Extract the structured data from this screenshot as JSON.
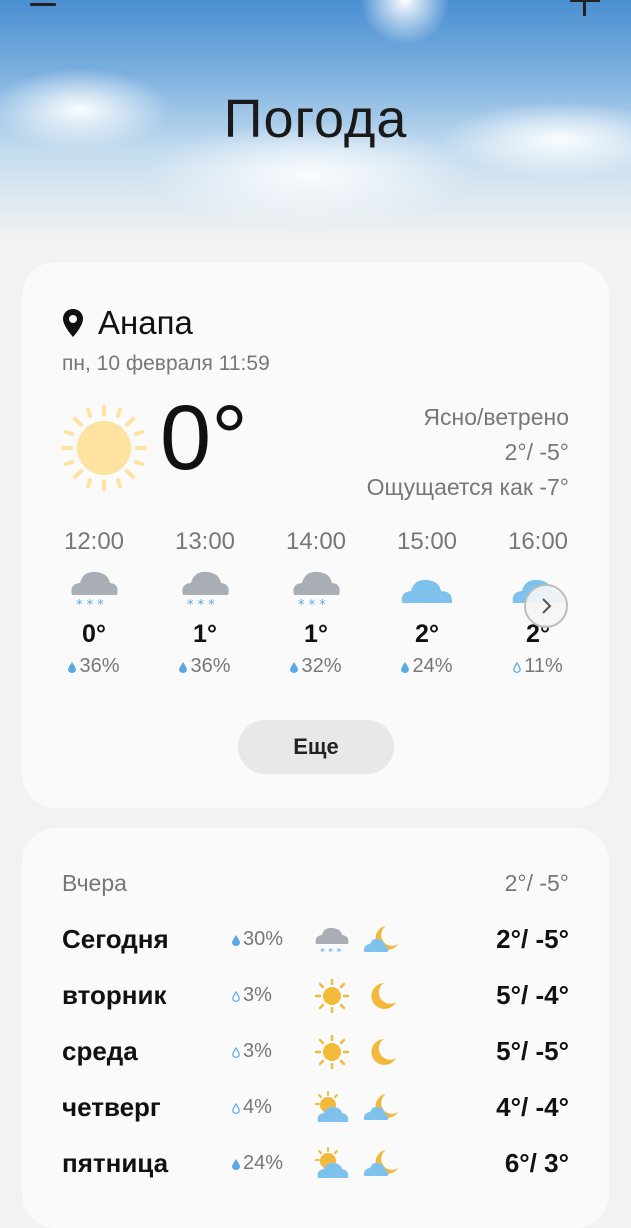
{
  "app": {
    "title": "Погода"
  },
  "current": {
    "city": "Анапа",
    "datetime": "пн, 10 февраля 11:59",
    "temp": "0°",
    "condition": "Ясно/ветрено",
    "hi_lo": "2°/ -5°",
    "feels_like": "Ощущается как -7°",
    "icon": "sun-icon"
  },
  "hourly": [
    {
      "time": "12:00",
      "temp": "0°",
      "precip": "36%",
      "icon": "snow-cloud-icon"
    },
    {
      "time": "13:00",
      "temp": "1°",
      "precip": "36%",
      "icon": "snow-cloud-icon"
    },
    {
      "time": "14:00",
      "temp": "1°",
      "precip": "32%",
      "icon": "snow-cloud-icon"
    },
    {
      "time": "15:00",
      "temp": "2°",
      "precip": "24%",
      "icon": "cloud-icon"
    },
    {
      "time": "16:00",
      "temp": "2°",
      "precip": "11%",
      "icon": "cloud-icon"
    }
  ],
  "buttons": {
    "more": "Еще"
  },
  "forecast": {
    "yesterday_label": "Вчера",
    "yesterday_temp": "2°/ -5°",
    "days": [
      {
        "name": "Сегодня",
        "precip": "30%",
        "day_icon": "snow-cloud-icon",
        "night_icon": "moon-cloud-icon",
        "temps": "2°/ -5°"
      },
      {
        "name": "вторник",
        "precip": "3%",
        "day_icon": "sun-icon",
        "night_icon": "moon-icon",
        "temps": "5°/ -4°"
      },
      {
        "name": "среда",
        "precip": "3%",
        "day_icon": "sun-icon",
        "night_icon": "moon-icon",
        "temps": "5°/ -5°"
      },
      {
        "name": "четверг",
        "precip": "4%",
        "day_icon": "sun-cloud-icon",
        "night_icon": "moon-cloud-icon",
        "temps": "4°/ -4°"
      },
      {
        "name": "пятница",
        "precip": "24%",
        "day_icon": "sun-cloud-icon",
        "night_icon": "moon-cloud-icon",
        "temps": "6°/ 3°"
      }
    ]
  },
  "colors": {
    "sun": "#fde2a0",
    "cloud_blue": "#7ec1ec",
    "cloud_grey": "#a9adb4",
    "snow": "#5aa9e6",
    "moon": "#f3b93a"
  }
}
